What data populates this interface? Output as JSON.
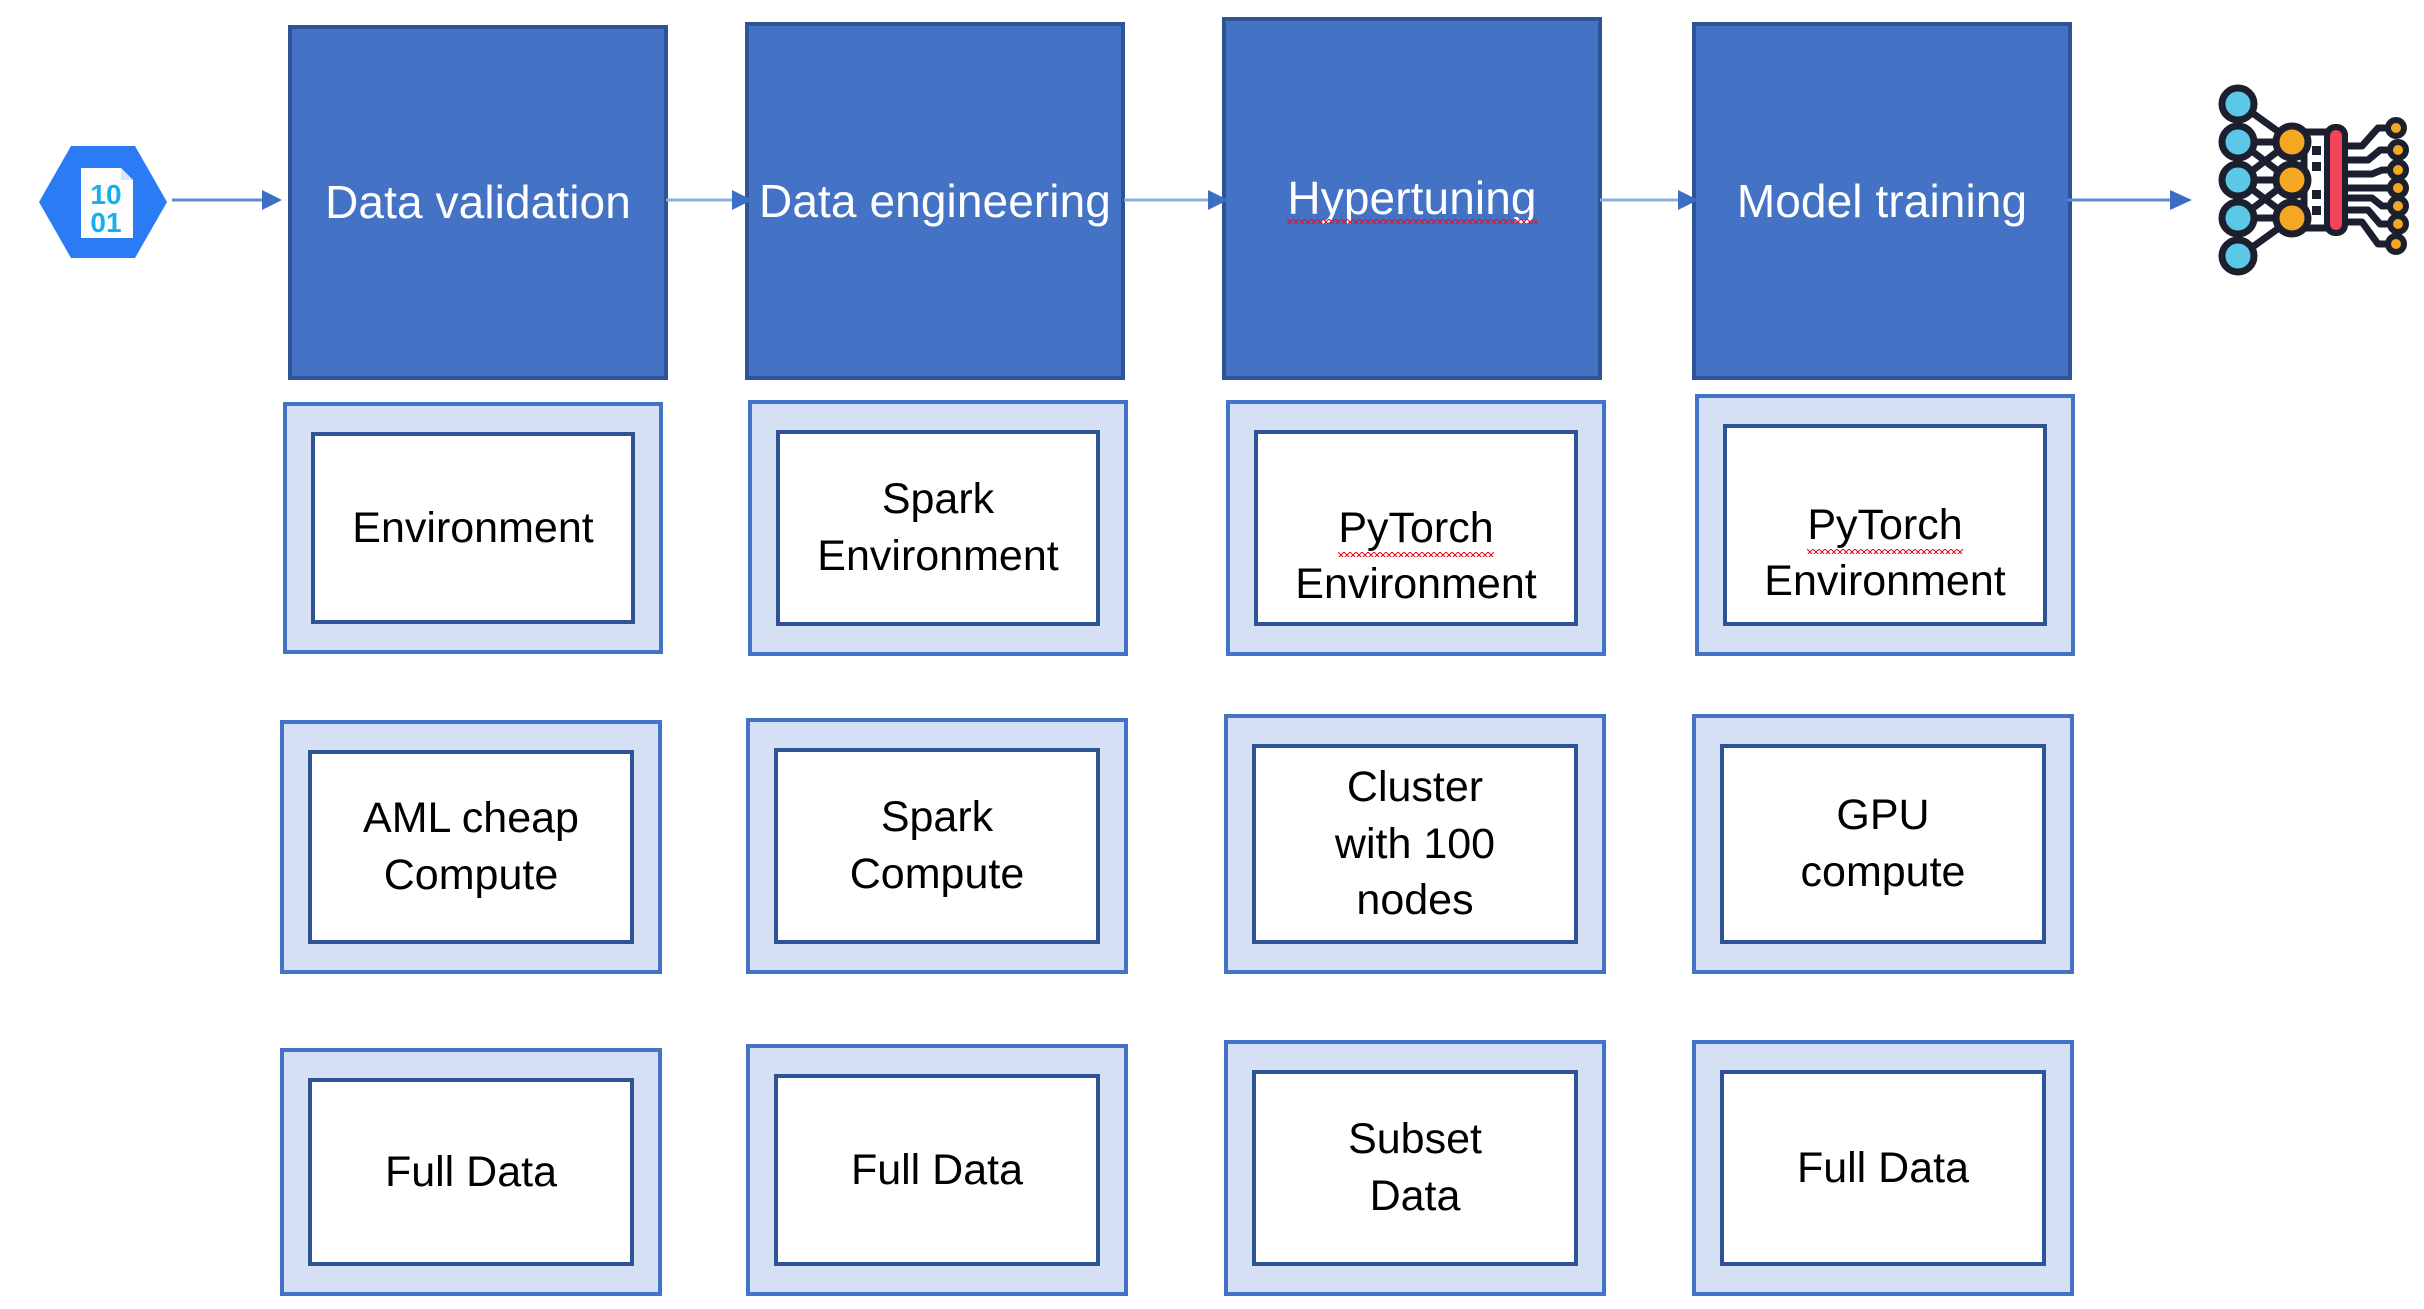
{
  "diagram": {
    "title": "ML pipeline stages with environment, compute and data per stage",
    "colors": {
      "stage_fill": "#4472C4",
      "stage_border": "#2E5496",
      "outer_fill": "#D6E0F5",
      "outer_border": "#4472C4",
      "inner_fill": "#FFFFFF",
      "inner_border": "#2E5496",
      "arrow": "#5B8BD0",
      "spellcheck_underline": "#E81123",
      "hexagon_blue": "#2B7CF4",
      "hexagon_digits": "#17B0EF",
      "nn_node_blue": "#5BC8E8",
      "nn_node_orange": "#F5A623",
      "nn_bar_red": "#F2445B",
      "nn_outline": "#1C1F2E"
    },
    "source_icon": {
      "name": "dataset-hexagon-icon",
      "digits_top": "10",
      "digits_bottom": "01"
    },
    "target_icon": {
      "name": "neural-network-icon",
      "input_nodes": 5,
      "hidden_nodes": 3,
      "output_nodes": 7
    },
    "stages": [
      {
        "id": "data-validation",
        "label": "Data validation",
        "misspelled": false,
        "environment": {
          "lines": "Environment",
          "misspelled_token": ""
        },
        "compute": {
          "lines": "AML cheap\nCompute"
        },
        "data": {
          "lines": "Full Data"
        }
      },
      {
        "id": "data-engineering",
        "label": "Data engineering",
        "misspelled": false,
        "environment": {
          "lines": "Spark\nEnvironment",
          "misspelled_token": ""
        },
        "compute": {
          "lines": "Spark\nCompute"
        },
        "data": {
          "lines": "Full Data"
        }
      },
      {
        "id": "hypertuning",
        "label": "Hypertuning",
        "misspelled": true,
        "environment": {
          "lines": "PyTorch\nEnvironment",
          "misspelled_token": "PyTorch"
        },
        "compute": {
          "lines": "Cluster\nwith 100\nnodes"
        },
        "data": {
          "lines": "Subset\nData"
        }
      },
      {
        "id": "model-training",
        "label": "Model training",
        "misspelled": false,
        "environment": {
          "lines": "PyTorch\nEnvironment",
          "misspelled_token": "PyTorch"
        },
        "compute": {
          "lines": "GPU\ncompute"
        },
        "data": {
          "lines": "Full Data"
        }
      }
    ],
    "arrows": [
      {
        "id": "arrow-source-to-stage1",
        "from": "dataset-icon",
        "to": "data-validation"
      },
      {
        "id": "arrow-stage1-to-stage2",
        "from": "data-validation",
        "to": "data-engineering"
      },
      {
        "id": "arrow-stage2-to-stage3",
        "from": "data-engineering",
        "to": "hypertuning"
      },
      {
        "id": "arrow-stage3-to-stage4",
        "from": "hypertuning",
        "to": "model-training"
      },
      {
        "id": "arrow-stage4-to-model",
        "from": "model-training",
        "to": "neural-network-icon"
      }
    ]
  }
}
